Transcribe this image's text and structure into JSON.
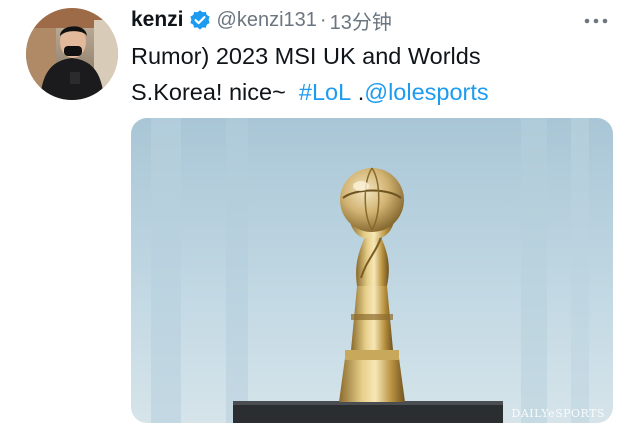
{
  "tweet": {
    "author": {
      "display_name": "kenzi",
      "handle": "@kenzi131",
      "verified": true,
      "avatar_icon": "avatar-photo-person-black-hoodie"
    },
    "separator": "·",
    "timestamp": "13分钟",
    "text": {
      "line1": "Rumor) 2023 MSI UK and Worlds",
      "line2_plain": "S.Korea! nice~",
      "hashtag": "#LoL",
      "line2_dot": ".",
      "mention": "@lolesports"
    },
    "media": {
      "description_icon": "trophy-photo",
      "watermark": "DAILYeSPORTS"
    },
    "more_icon": "ellipsis-icon"
  },
  "colors": {
    "text": "#0f1419",
    "secondary": "#6b7680",
    "link": "#1d9bf0",
    "verified": "#1d9bf0",
    "background": "#ffffff"
  }
}
